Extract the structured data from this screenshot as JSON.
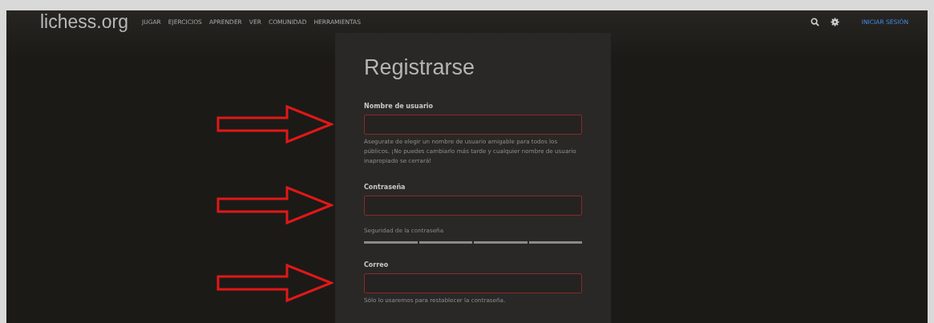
{
  "header": {
    "logo": "lichess.org",
    "nav": [
      "JUGAR",
      "EJERCICIOS",
      "APRENDER",
      "VER",
      "COMUNIDAD",
      "HERRAMIENTAS"
    ],
    "login": "INICIAR SESIÓN"
  },
  "form": {
    "title": "Registrarse",
    "fields": [
      {
        "kind": "text",
        "label": "Nombre de usuario",
        "error": true,
        "help": "Asegurate de elegir un nombre de usuario amigable para todos los públicos. ¡No puedes cambiarlo más tarde y cualquier nombre de usuario inapropiado se cerrará!"
      },
      {
        "kind": "password",
        "label": "Contraseña",
        "error": true,
        "strength_label": "Seguridad de la contraseña"
      },
      {
        "kind": "email",
        "label": "Correo",
        "error": true,
        "help": "Sólo lo usaremos para restablecer la contraseña."
      }
    ]
  }
}
